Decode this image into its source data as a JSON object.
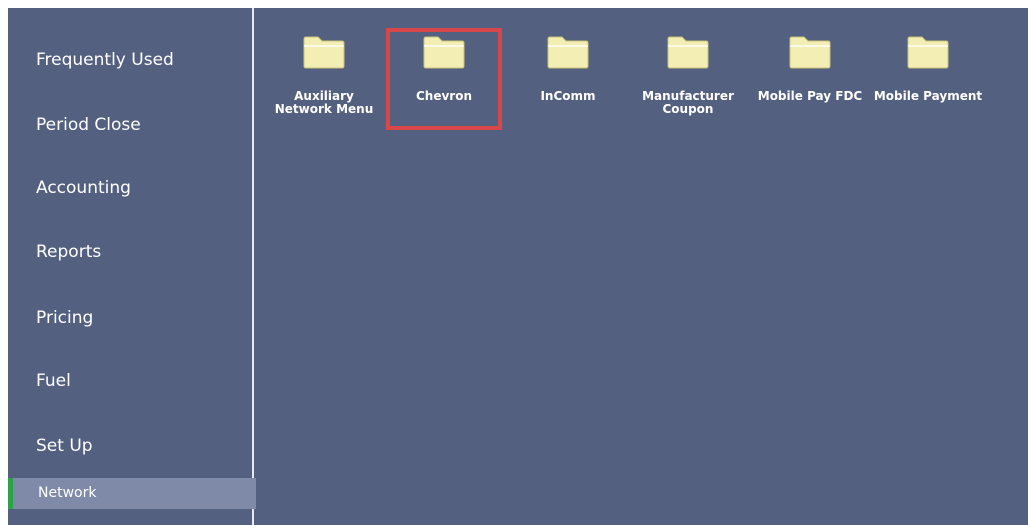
{
  "sidebar": {
    "items": [
      {
        "label": "Frequently Used"
      },
      {
        "label": "Period Close"
      },
      {
        "label": "Accounting"
      },
      {
        "label": "Reports"
      },
      {
        "label": "Pricing"
      },
      {
        "label": "Fuel"
      },
      {
        "label": "Set Up"
      }
    ],
    "subitem": {
      "label": "Network",
      "active": true
    }
  },
  "folders": [
    {
      "label": "Auxiliary\nNetwork Menu",
      "icon": "folder-icon"
    },
    {
      "label": "Chevron",
      "icon": "folder-icon",
      "selected": true
    },
    {
      "label": "InComm",
      "icon": "folder-icon"
    },
    {
      "label": "Manufacturer\nCoupon",
      "icon": "folder-icon"
    },
    {
      "label": "Mobile Pay FDC",
      "icon": "folder-icon"
    },
    {
      "label": "Mobile Payment",
      "icon": "folder-icon"
    }
  ],
  "colors": {
    "background": "#53607f",
    "subitem_background": "#7f8aa8",
    "active_indicator": "#2da24a",
    "selection_outline": "#d8474a",
    "folder_fill": "#f3efb4"
  }
}
